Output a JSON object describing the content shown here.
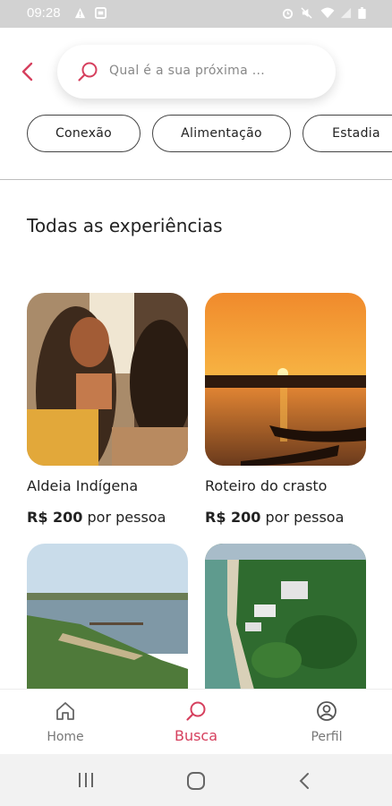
{
  "status_bar": {
    "time": "09:28",
    "left_icons": [
      "warning-icon",
      "image-icon"
    ],
    "right_icons": [
      "alarm-icon",
      "mute-icon",
      "wifi-icon",
      "signal-icon",
      "battery-icon"
    ]
  },
  "header": {
    "back_icon": "chevron-left-icon",
    "search_placeholder": "Qual é a sua próxima ..."
  },
  "categories": [
    "Conexão",
    "Alimentação",
    "Estadia"
  ],
  "section_title": "Todas as experiências",
  "experiences": [
    {
      "title": "Aldeia Indígena",
      "price": "R$ 200",
      "unit": "por pessoa",
      "image": "indigenous-village-photo"
    },
    {
      "title": "Roteiro do crasto",
      "price": "R$ 200",
      "unit": "por pessoa",
      "image": "sunset-canoe-photo"
    },
    {
      "title": "",
      "price": "",
      "unit": "",
      "image": "lagoon-shore-photo"
    },
    {
      "title": "",
      "price": "",
      "unit": "",
      "image": "aerial-coast-photo"
    }
  ],
  "bottom_nav": [
    {
      "label": "Home",
      "icon": "home-icon",
      "active": false
    },
    {
      "label": "Busca",
      "icon": "search-icon",
      "active": true
    },
    {
      "label": "Perfil",
      "icon": "profile-icon",
      "active": false
    }
  ],
  "colors": {
    "accent": "#d6405e",
    "text": "#222222",
    "inactive": "#777777"
  },
  "system_nav": [
    "recents-icon",
    "home-circle-icon",
    "back-icon"
  ]
}
